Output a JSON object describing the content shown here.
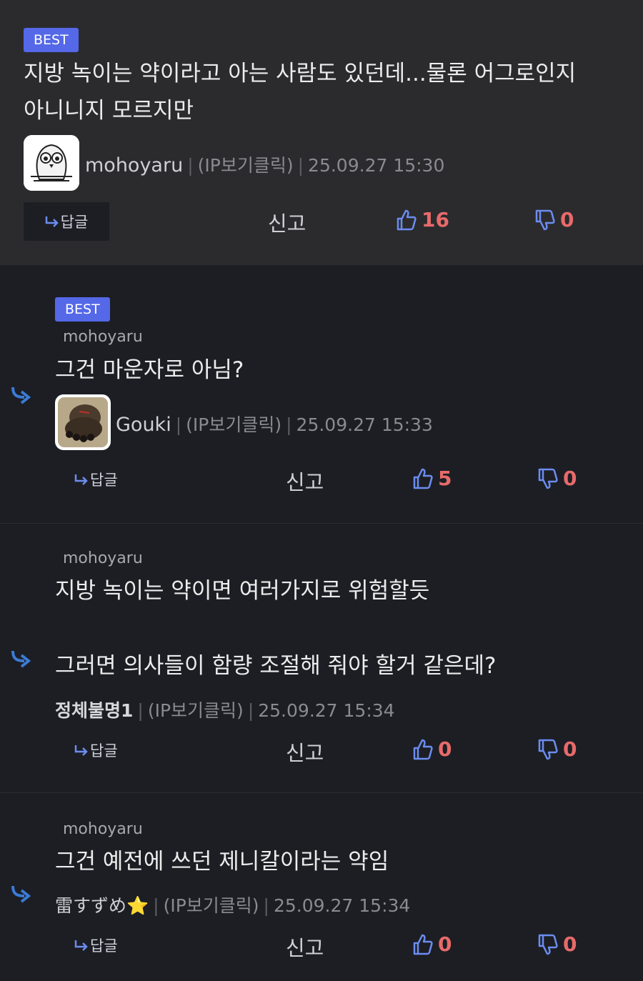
{
  "comments": [
    {
      "badge": "BEST",
      "text_lines": [
        "지방 녹이는 약이라고 아는 사람도 있던데...물론 어그로인지",
        "아니니지 모르지만"
      ],
      "nick": "mohoyaru",
      "ip": "(IP보기클릭)",
      "time": "25.09.27 15:30",
      "reply_label": "답글",
      "report_label": "신고",
      "likes": "16",
      "dislikes": "0"
    },
    {
      "badge": "BEST",
      "reply_to": "mohoyaru",
      "text_lines": [
        "그건 마운자로 아님?"
      ],
      "nick": "Gouki",
      "ip": "(IP보기클릭)",
      "time": "25.09.27 15:33",
      "reply_label": "답글",
      "report_label": "신고",
      "likes": "5",
      "dislikes": "0"
    },
    {
      "reply_to": "mohoyaru",
      "text_lines": [
        "지방 녹이는 약이면 여러가지로 위험할듯",
        "그러면 의사들이 함량 조절해 줘야 할거 같은데?"
      ],
      "nick": "정체불명1",
      "ip": "(IP보기클릭)",
      "time": "25.09.27 15:34",
      "reply_label": "답글",
      "report_label": "신고",
      "likes": "0",
      "dislikes": "0"
    },
    {
      "reply_to": "mohoyaru",
      "text_lines": [
        "그건 예전에 쓰던 제니칼이라는 약임"
      ],
      "nick": "雷すずめ⭐",
      "ip": "(IP보기클릭)",
      "time": "25.09.27 15:34",
      "reply_label": "답글",
      "report_label": "신고",
      "likes": "0",
      "dislikes": "0"
    }
  ],
  "colors": {
    "badge": "#5468e8",
    "vote": "#e86a6a",
    "icon_blue": "#6c8cf0",
    "reply_arrow": "#3a7bd5"
  },
  "icons": [
    "reply-arrow-icon",
    "thumbs-up-icon",
    "thumbs-down-icon",
    "owl-avatar",
    "gouki-avatar"
  ]
}
